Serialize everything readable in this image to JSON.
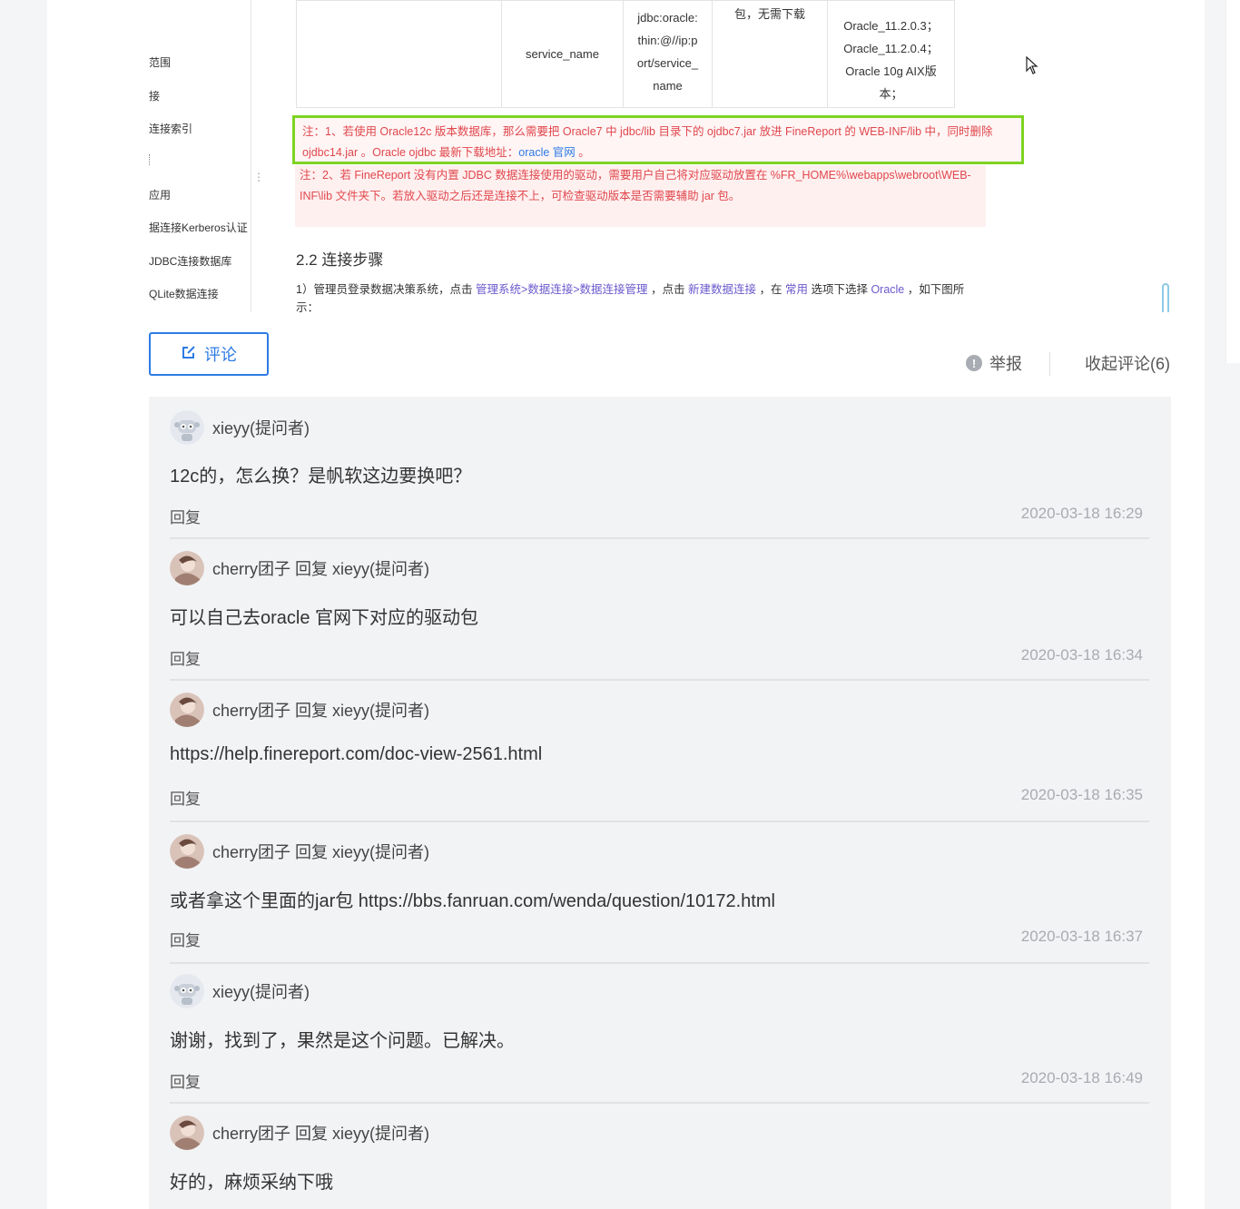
{
  "doc_sidebar": {
    "items": [
      "范围",
      "接",
      "连接索引",
      "",
      "应用",
      "据连接Kerberos认证",
      "JDBC连接数据库",
      "QLite数据连接"
    ]
  },
  "doc_table": {
    "col_service": "service_name",
    "url_lines": [
      "jdbc:oracle:",
      "thin:@//ip:p",
      "ort/service_",
      "name"
    ],
    "driver_note": "包，无需下载",
    "versions": [
      "Oracle_11.2.0.3；",
      "Oracle_11.2.0.4；",
      "Oracle 10g AIX版",
      "本；"
    ]
  },
  "notes": {
    "note1_text": "注：1、若使用 Oracle12c 版本数据库，那么需要把 Oracle7 中 jdbc/lib 目录下的 ojdbc7.jar 放进 FineReport 的 WEB-INF/lib 中，同时删除 ojdbc14.jar 。Oracle ojdbc 最新下载地址：",
    "note1_link": "oracle 官网",
    "note1_end": " 。",
    "note2_text": "注：2、若 FineReport 没有内置 JDBC 数据连接使用的驱动，需要用户自己将对应驱动放置在 %FR_HOME%\\webapps\\webroot\\WEB-INF\\lib 文件夹下。若放入驱动之后还是连接不上，可检查驱动版本是否需要辅助 jar 包。"
  },
  "section": {
    "title": "2.2 连接步骤",
    "step_prefix": "1）管理员登录数据决策系统，点击 ",
    "step_path": "管理系统>数据连接>数据连接管理",
    "step_mid1": " ，点击 ",
    "step_new": "新建数据连接",
    "step_mid2": " ，在 ",
    "step_common": "常用",
    "step_mid3": " 选项下选择 ",
    "step_oracle": "Oracle",
    "step_end": " ，如下图所示："
  },
  "actions": {
    "comment_label": "评论",
    "report_label": "举报",
    "collapse_label": "收起评论(6)"
  },
  "comments": [
    {
      "author": "xieyy(提问者)",
      "body": "12c的，怎么换？是帆软这边要换吧？",
      "reply": "回复",
      "time": "2020-03-18 16:29"
    },
    {
      "author": "cherry团子 回复 xieyy(提问者)",
      "body": "可以自己去oracle 官网下对应的驱动包",
      "reply": "回复",
      "time": "2020-03-18 16:34"
    },
    {
      "author": "cherry团子 回复 xieyy(提问者)",
      "body": "https://help.finereport.com/doc-view-2561.html",
      "reply": "回复",
      "time": "2020-03-18 16:35"
    },
    {
      "author": "cherry团子 回复 xieyy(提问者)",
      "body": "或者拿这个里面的jar包 https://bbs.fanruan.com/wenda/question/10172.html",
      "reply": "回复",
      "time": "2020-03-18 16:37"
    },
    {
      "author": "xieyy(提问者)",
      "body": "谢谢，找到了，果然是这个问题。已解决。",
      "reply": "回复",
      "time": "2020-03-18 16:49"
    },
    {
      "author": "cherry团子 回复 xieyy(提问者)",
      "body": "好的，麻烦采纳下哦",
      "reply": "",
      "time": ""
    }
  ],
  "colors": {
    "accent": "#2d7be5",
    "note_red": "#e0474c",
    "highlight_green": "#7ed321"
  }
}
